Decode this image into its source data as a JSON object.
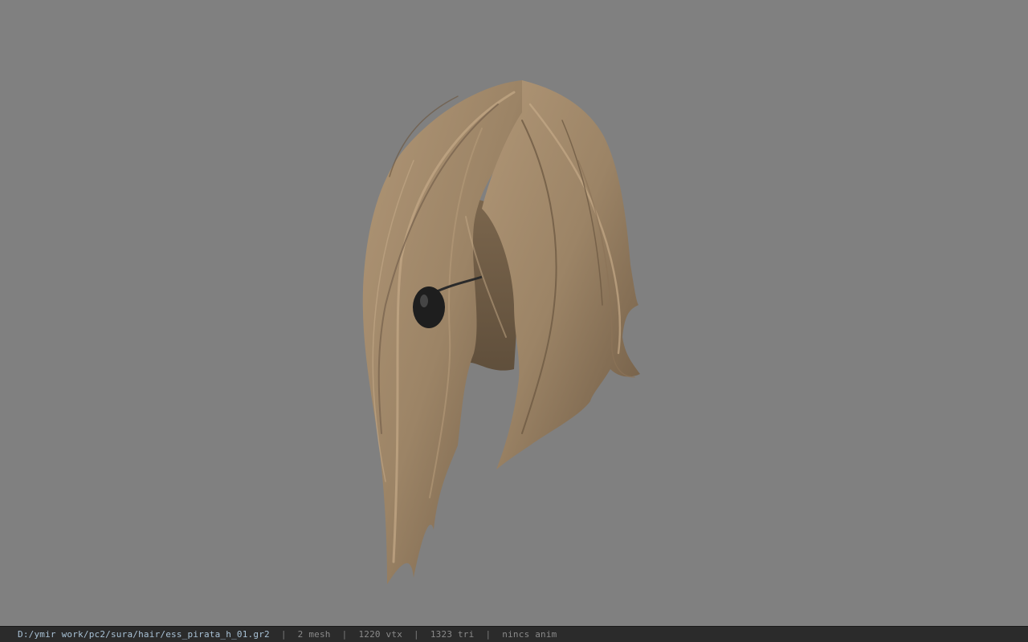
{
  "viewer": {
    "background_color": "#808080",
    "model": {
      "name": "hair-model",
      "hair_color": "#9c8466",
      "accessory": "black earring"
    }
  },
  "status_bar": {
    "file_path": "D:/ymir work/pc2/sura/hair/ess_pirata_h_01.gr2",
    "mesh_count": "2 mesh",
    "vertex_count": "1220 vtx",
    "triangle_count": "1323 tri",
    "anim_info": "nincs anim",
    "separator": "|"
  }
}
